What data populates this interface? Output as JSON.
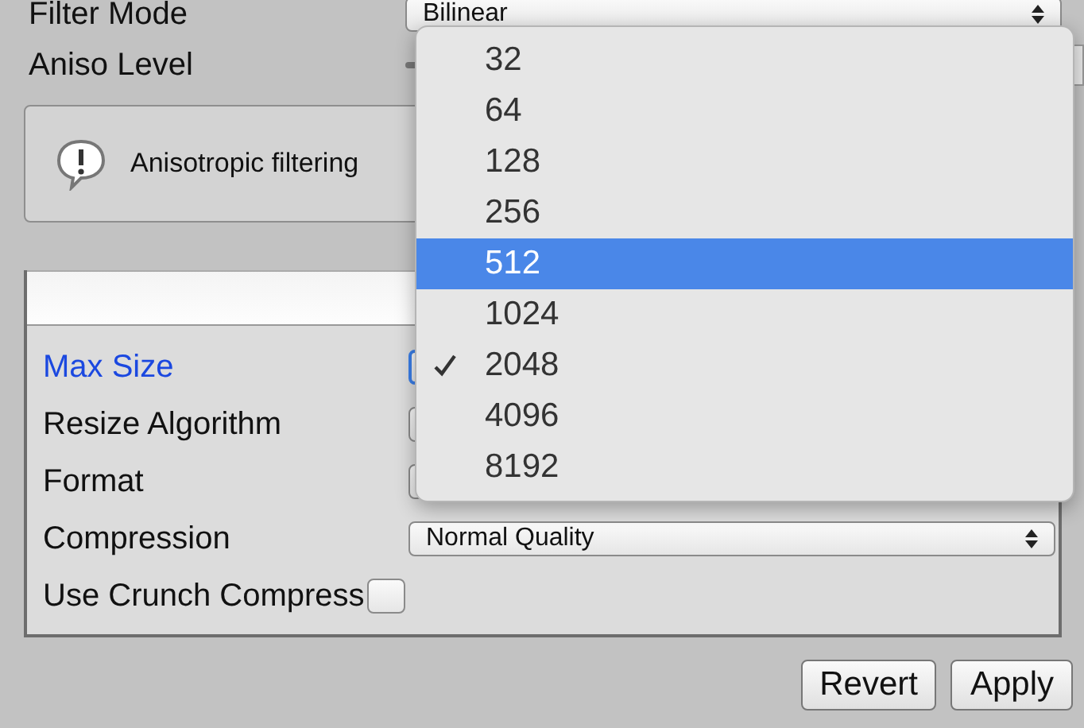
{
  "filter_mode": {
    "label": "Filter Mode",
    "value": "Bilinear"
  },
  "aniso_level": {
    "label": "Aniso Level"
  },
  "help_box": {
    "text": "Anisotropic filtering"
  },
  "platform_settings": {
    "rows": [
      {
        "label": "Max Size",
        "kind": "dropdown",
        "focused": true
      },
      {
        "label": "Resize Algorithm",
        "kind": "dropdown",
        "focused": false
      },
      {
        "label": "Format",
        "kind": "dropdown",
        "focused": false
      },
      {
        "label": "Compression",
        "kind": "dropdown",
        "focused": false,
        "value": "Normal Quality"
      },
      {
        "label": "Use Crunch Compress",
        "kind": "checkbox",
        "checked": false
      }
    ]
  },
  "buttons": [
    "Revert",
    "Apply"
  ],
  "size_menu": {
    "items": [
      {
        "label": "32",
        "selected": false,
        "checked": false
      },
      {
        "label": "64",
        "selected": false,
        "checked": false
      },
      {
        "label": "128",
        "selected": false,
        "checked": false
      },
      {
        "label": "256",
        "selected": false,
        "checked": false
      },
      {
        "label": "512",
        "selected": true,
        "checked": false
      },
      {
        "label": "1024",
        "selected": false,
        "checked": false
      },
      {
        "label": "2048",
        "selected": false,
        "checked": true
      },
      {
        "label": "4096",
        "selected": false,
        "checked": false
      },
      {
        "label": "8192",
        "selected": false,
        "checked": false
      }
    ]
  }
}
